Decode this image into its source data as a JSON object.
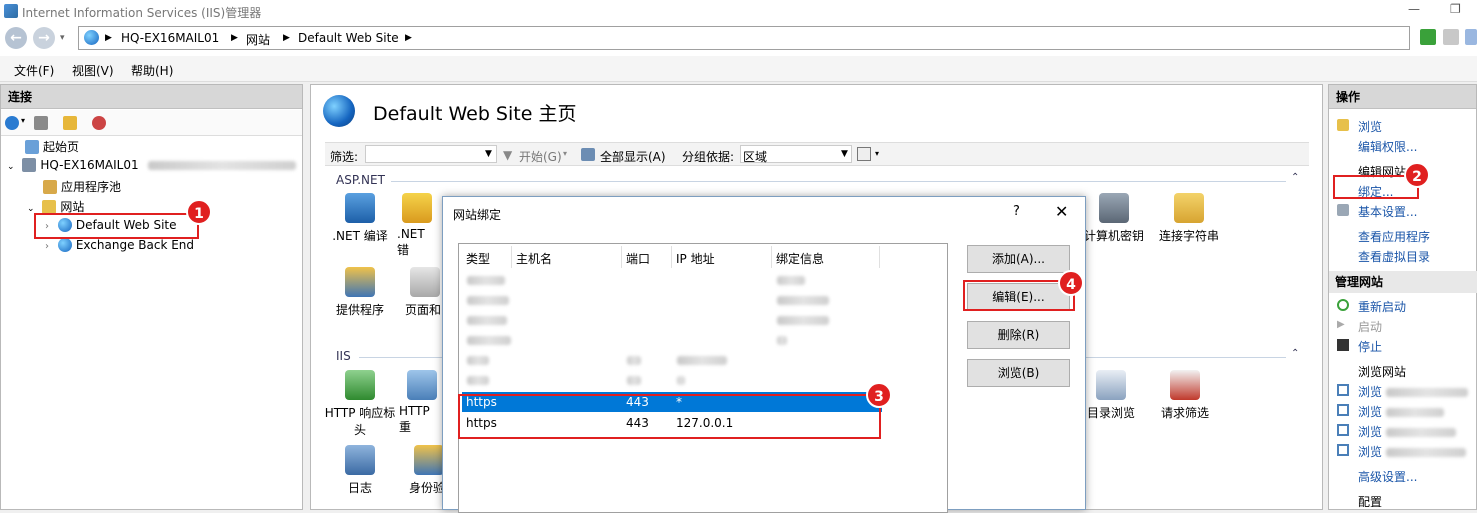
{
  "window": {
    "title": "Internet Information Services (IIS)管理器"
  },
  "address": {
    "server": "HQ-EX16MAIL01",
    "sites": "网站",
    "site": "Default Web Site"
  },
  "menu": {
    "file": "文件(F)",
    "view": "视图(V)",
    "help": "帮助(H)"
  },
  "left": {
    "title": "连接",
    "tree": {
      "start": "起始页",
      "server": "HQ-EX16MAIL01",
      "apppools": "应用程序池",
      "sites": "网站",
      "default_site": "Default Web Site",
      "exchange": "Exchange Back End"
    }
  },
  "center": {
    "title": "Default Web Site 主页",
    "filter": {
      "label": "筛选:",
      "start": "开始(G)",
      "show_all": "全部显示(A)",
      "group_label": "分组依据:",
      "group_value": "区域"
    },
    "groups": {
      "aspnet": "ASP.NET",
      "iis": "IIS"
    },
    "features": {
      "net_compile": ".NET 编译",
      "net_error": ".NET 错",
      "machine_key": "计算机密钥",
      "conn_strings": "连接字符串",
      "providers": "提供程序",
      "pages": "页面和",
      "http_headers": "HTTP 响应标头",
      "http_redirect": "HTTP 重",
      "dir_browse": "目录浏览",
      "req_filter": "请求筛选",
      "logging": "日志",
      "auth": "身份验"
    }
  },
  "right": {
    "title": "操作",
    "browse": "浏览",
    "edit_perms": "编辑权限...",
    "edit_site": "编辑网站",
    "bindings": "绑定...",
    "basic_settings": "基本设置...",
    "view_apps": "查看应用程序",
    "view_vdirs": "查看虚拟目录",
    "manage_site": "管理网站",
    "restart": "重新启动",
    "start": "启动",
    "stop": "停止",
    "browse_site": "浏览网站",
    "browse_item": "浏览",
    "advanced": "高级设置...",
    "config": "配置"
  },
  "dialog": {
    "title": "网站绑定",
    "help": "?",
    "close": "✕",
    "columns": {
      "type": "类型",
      "host": "主机名",
      "port": "端口",
      "ip": "IP 地址",
      "info": "绑定信息"
    },
    "rows": [
      {
        "type": "https",
        "port": "443",
        "ip": "*"
      },
      {
        "type": "https",
        "port": "443",
        "ip": "127.0.0.1"
      }
    ],
    "buttons": {
      "add": "添加(A)...",
      "edit": "编辑(E)...",
      "remove": "删除(R)",
      "browse": "浏览(B)"
    }
  },
  "badges": {
    "b1": "1",
    "b2": "2",
    "b3": "3",
    "b4": "4"
  }
}
